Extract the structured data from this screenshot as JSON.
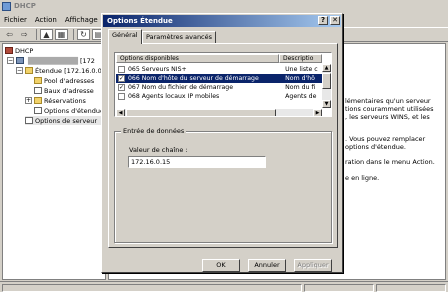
{
  "main": {
    "title": "DHCP",
    "menu": [
      "Fichier",
      "Action",
      "Affichage",
      "?"
    ],
    "tree": {
      "root": "DHCP",
      "server_suffix": "[172",
      "scope": "Étendue [172.16.0.0]",
      "items": [
        "Pool d'adresses",
        "Baux d'adresse",
        "Réservations",
        "Options d'étendue",
        "Options de serveur"
      ]
    },
    "right_text": [
      "lémentaires qu'un serveur",
      "tions couramment utilisées",
      ", les serveurs WINS, et les",
      ". Vous pouvez remplacer",
      "options d'étendue.",
      "ration dans le menu Action.",
      "e en ligne."
    ]
  },
  "dialog": {
    "title": "Options Étendue",
    "help_btn": "?",
    "close_btn": "✕",
    "tabs": [
      "Général",
      "Paramètres avancés"
    ],
    "list": {
      "headers": [
        "Options disponibles",
        "Descriptio"
      ],
      "rows": [
        {
          "checked": false,
          "name": "065 Serveurs NIS+",
          "desc": "Une liste c"
        },
        {
          "checked": true,
          "name": "066 Nom d'hôte du serveur de démarrage",
          "desc": "Nom d'hô"
        },
        {
          "checked": true,
          "name": "067 Nom du fichier de démarrage",
          "desc": "Nom du fi"
        },
        {
          "checked": false,
          "name": "068 Agents locaux IP mobiles",
          "desc": "Agents de"
        }
      ]
    },
    "group_label": "Entrée de données",
    "field_label": "Valeur de chaîne :",
    "field_value": "172.16.0.15",
    "buttons": {
      "ok": "OK",
      "cancel": "Annuler",
      "apply": "Appliquer"
    }
  }
}
